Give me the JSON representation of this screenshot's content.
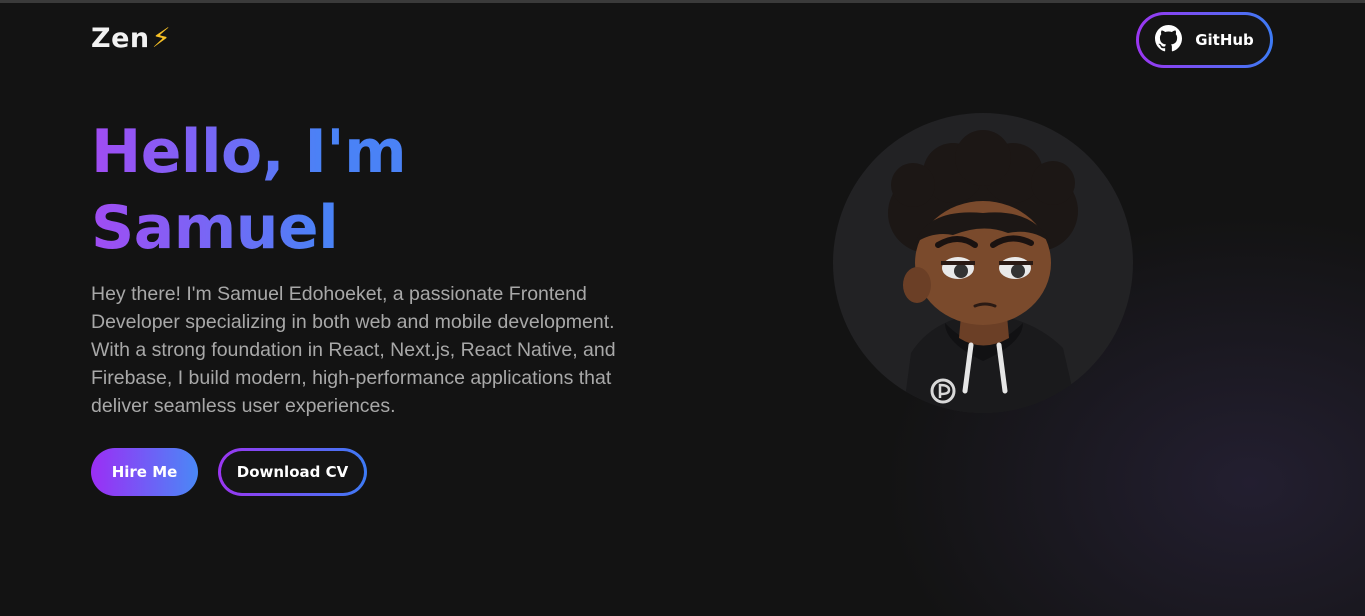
{
  "brand": {
    "logo_text": "Zen",
    "logo_icon": "lightning-bolt-icon",
    "logo_glyph": "⚡"
  },
  "nav": {
    "github_label": "GitHub",
    "github_icon": "github-icon"
  },
  "hero": {
    "title_line1": "Hello, I'm",
    "title_line2": "Samuel",
    "description": "Hey there! I'm Samuel Edohoeket, a passionate Frontend Developer specializing in both web and mobile development. With a strong foundation in React, Next.js, React Native, and Firebase, I build modern, high-performance applications that deliver seamless user experiences.",
    "hire_label": "Hire Me",
    "cv_label": "Download CV"
  },
  "colors": {
    "background": "#131313",
    "gradient_start": "#9b36f2",
    "gradient_end": "#3d7bf5",
    "body_text": "#a8a8a8",
    "bolt": "#f6c026"
  }
}
